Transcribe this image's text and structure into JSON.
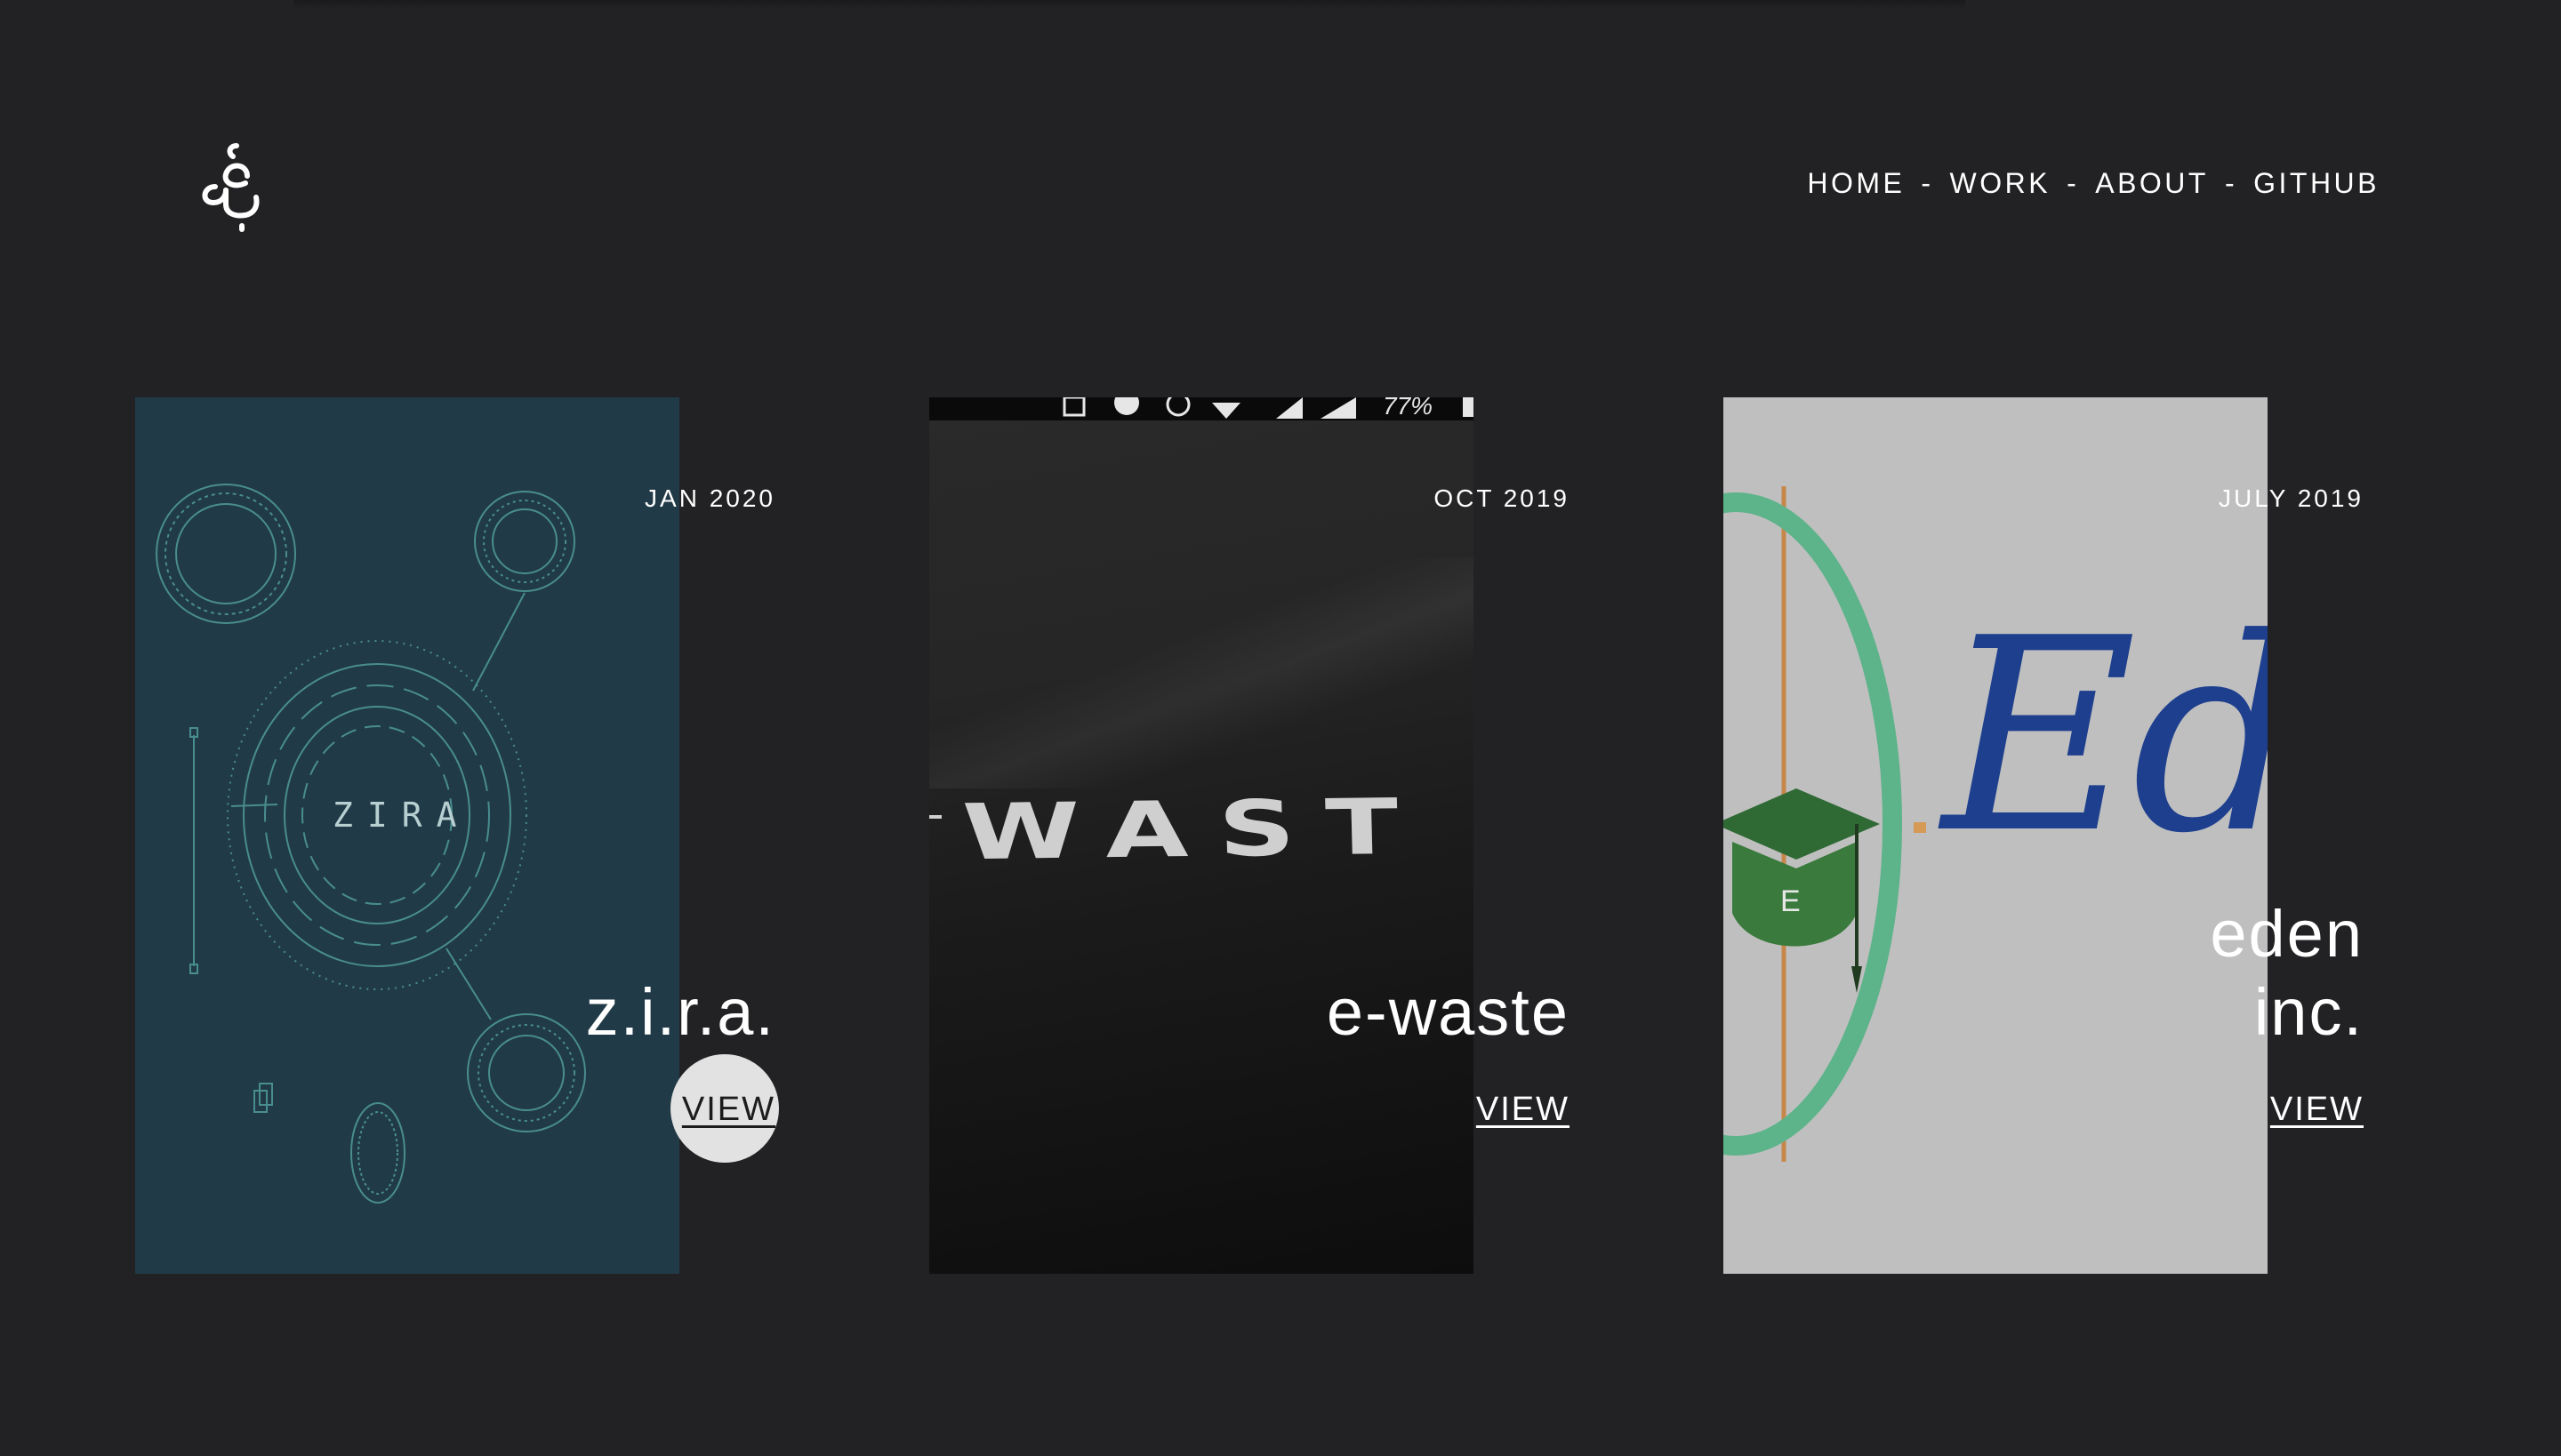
{
  "header": {
    "logo_icon": "monogram-logo-icon",
    "nav": [
      {
        "label": "HOME"
      },
      {
        "label": "WORK"
      },
      {
        "label": "ABOUT"
      },
      {
        "label": "GITHUB"
      }
    ],
    "separator": "-"
  },
  "projects": [
    {
      "date": "JAN 2020",
      "title_lines": [
        "z.i.r.a."
      ],
      "view_label": "VIEW",
      "thumbnail_text": "ZIRA",
      "image_bg": "#213a47"
    },
    {
      "date": "OCT 2019",
      "title_lines": [
        "e-waste"
      ],
      "view_label": "VIEW",
      "thumbnail_text": "WAST",
      "status_bar_text": "77%",
      "image_bg": "#1b1b1b"
    },
    {
      "date": "JULY 2019",
      "title_lines": [
        "eden",
        "inc."
      ],
      "view_label": "VIEW",
      "thumbnail_text": "Eden",
      "thumbnail_badge": "E",
      "image_bg": "#bfbfbf"
    }
  ],
  "colors": {
    "background": "#222224",
    "text": "#ffffff",
    "hover_bubble": "#e2e2e2"
  }
}
